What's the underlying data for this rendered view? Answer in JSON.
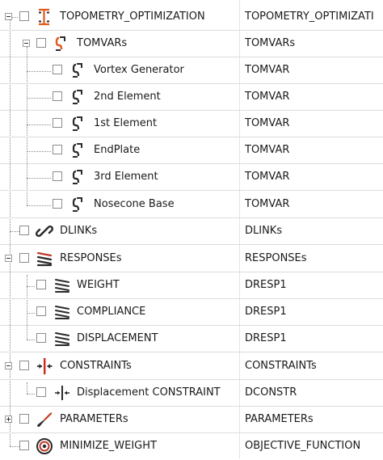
{
  "tree": {
    "root": {
      "name": "TOPOMETRY_OPTIMIZATION",
      "type": "TOPOMETRY_OPTIMIZATI"
    },
    "tomvars": {
      "name": "TOMVARs",
      "type": "TOMVARs",
      "children": [
        {
          "name": "Vortex Generator",
          "type": "TOMVAR"
        },
        {
          "name": "2nd Element",
          "type": "TOMVAR"
        },
        {
          "name": "1st Element",
          "type": "TOMVAR"
        },
        {
          "name": "EndPlate",
          "type": "TOMVAR"
        },
        {
          "name": "3rd Element",
          "type": "TOMVAR"
        },
        {
          "name": "Nosecone Base",
          "type": "TOMVAR"
        }
      ]
    },
    "dlinks": {
      "name": "DLINKs",
      "type": "DLINKs"
    },
    "responses": {
      "name": "RESPONSEs",
      "type": "RESPONSEs",
      "children": [
        {
          "name": "WEIGHT",
          "type": "DRESP1"
        },
        {
          "name": "COMPLIANCE",
          "type": "DRESP1"
        },
        {
          "name": "DISPLACEMENT",
          "type": "DRESP1"
        }
      ]
    },
    "constraints": {
      "name": "CONSTRAINTs",
      "type": "CONSTRAINTs",
      "children": [
        {
          "name": "Displacement CONSTRAINT",
          "type": "DCONSTR"
        }
      ]
    },
    "parameters": {
      "name": "PARAMETERs",
      "type": "PARAMETERs"
    },
    "objective": {
      "name": "MINIMIZE_WEIGHT",
      "type": "OBJECTIVE_FUNCTION"
    }
  },
  "colors": {
    "root_icon": "#e05a1e",
    "tomvar_icon": "#e0581c",
    "node_icon_dark": "#2a2a2a",
    "constraint_icon": "#d0261e",
    "parameter_icon": "#c2391b",
    "objective_icon": "#c0392b"
  }
}
